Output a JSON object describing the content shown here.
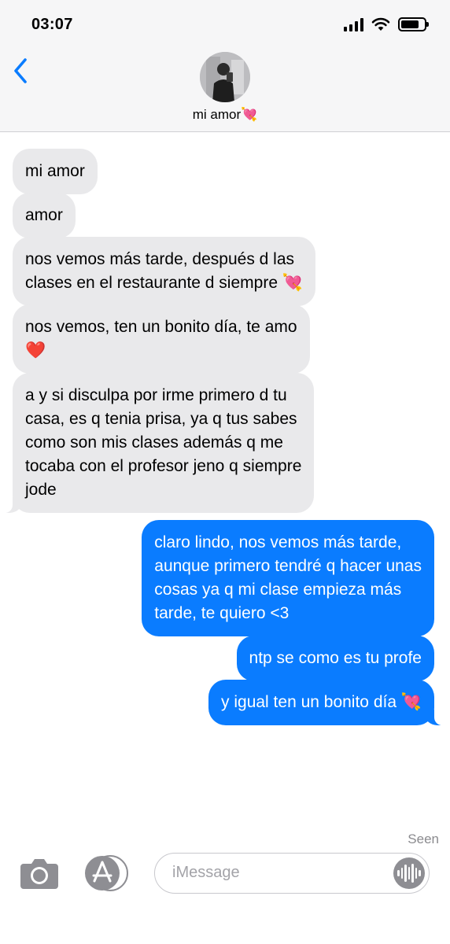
{
  "status_bar": {
    "time": "03:07"
  },
  "header": {
    "contact_name": "mi amor💘"
  },
  "messages": [
    {
      "from": "them",
      "text": "mi amor"
    },
    {
      "from": "them",
      "text": "amor"
    },
    {
      "from": "them",
      "text": "nos vemos más tarde, después d las\nclases en el restaurante d siempre 💘"
    },
    {
      "from": "them",
      "text": "nos vemos, ten un bonito día, te amo\n❤️"
    },
    {
      "from": "them",
      "text": "a y si disculpa por irme primero d tu\ncasa, es q tenia prisa, ya q tus sabes\ncomo son mis clases además q me\ntocaba con el profesor jeno q siempre\njode"
    },
    {
      "from": "me",
      "text": "claro lindo, nos vemos más tarde,\naunque primero tendré q hacer unas\ncosas ya q mi clase empieza más\ntarde, te quiero <3"
    },
    {
      "from": "me",
      "text": "ntp se como es tu profe"
    },
    {
      "from": "me",
      "text": "y igual ten un bonito día 💘"
    }
  ],
  "receipt": "Seen",
  "composer": {
    "placeholder": "iMessage"
  },
  "icons": {
    "back": "chevron-left-icon",
    "camera": "camera-icon",
    "apps": "app-store-icon",
    "voice": "waveform-icon"
  },
  "colors": {
    "sent_bubble": "#0a7cff",
    "received_bubble": "#e9e9eb",
    "accent": "#0a7cff"
  }
}
